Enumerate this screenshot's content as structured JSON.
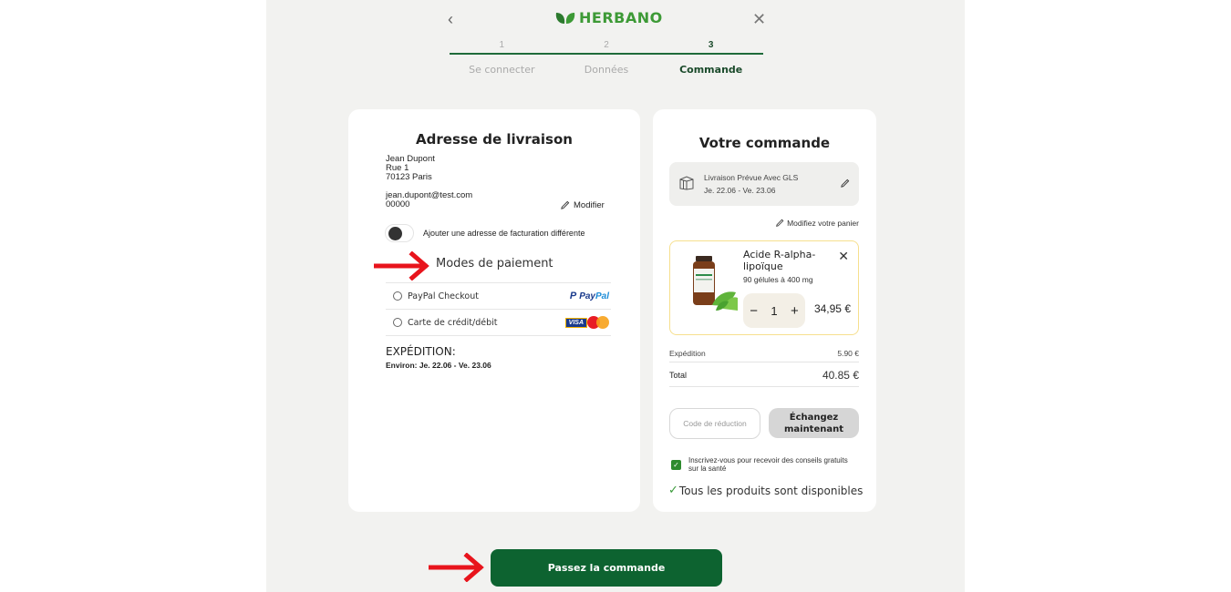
{
  "header": {
    "brand": "HERBANO",
    "back_icon": "chevron-left-icon",
    "close_icon": "close-icon"
  },
  "steps": [
    {
      "number": "1",
      "label": "Se connecter",
      "active": false
    },
    {
      "number": "2",
      "label": "Données",
      "active": false
    },
    {
      "number": "3",
      "label": "Commande",
      "active": true
    }
  ],
  "shipping_address": {
    "title": "Adresse de livraison",
    "name": "Jean Dupont",
    "street": "Rue 1",
    "city": "70123 Paris",
    "email": "jean.dupont@test.com",
    "phone": "00000",
    "modify_label": "Modifier",
    "billing_toggle_label": "Ajouter une adresse de facturation différente"
  },
  "payment": {
    "title": "Modes de paiement",
    "methods": [
      {
        "label": "PayPal Checkout",
        "logo": "PayPal"
      },
      {
        "label": "Carte de crédit/débit",
        "logo": "VISA / Mastercard"
      }
    ]
  },
  "expedition": {
    "title": "EXPÉDITION:",
    "estimate": "Environ: Je. 22.06 - Ve. 23.06"
  },
  "order": {
    "title": "Votre commande",
    "delivery_line1": "Livraison Prévue Avec GLS",
    "delivery_line2": "Je. 22.06 - Ve. 23.06",
    "modify_cart_label": "Modifiez votre panier",
    "product": {
      "name": "Acide R-alpha-lipoïque",
      "subtitle": "90 gélules à 400 mg",
      "quantity": "1",
      "price": "34,95 €"
    },
    "shipping_label": "Expédition",
    "shipping_value": "5.90 €",
    "total_label": "Total",
    "total_value": "40.85 €",
    "coupon_placeholder": "Code de réduction",
    "redeem_label": "Échangez maintenant",
    "newsletter_label": "Inscrivez-vous pour recevoir des conseils gratuits sur la santé",
    "newsletter_checked": true,
    "availability": "Tous les produits sont disponibles"
  },
  "cta_label": "Passez la commande",
  "colors": {
    "brand_green": "#3d9a36",
    "cta_green": "#0d6330",
    "annotation_red": "#e8141c"
  }
}
